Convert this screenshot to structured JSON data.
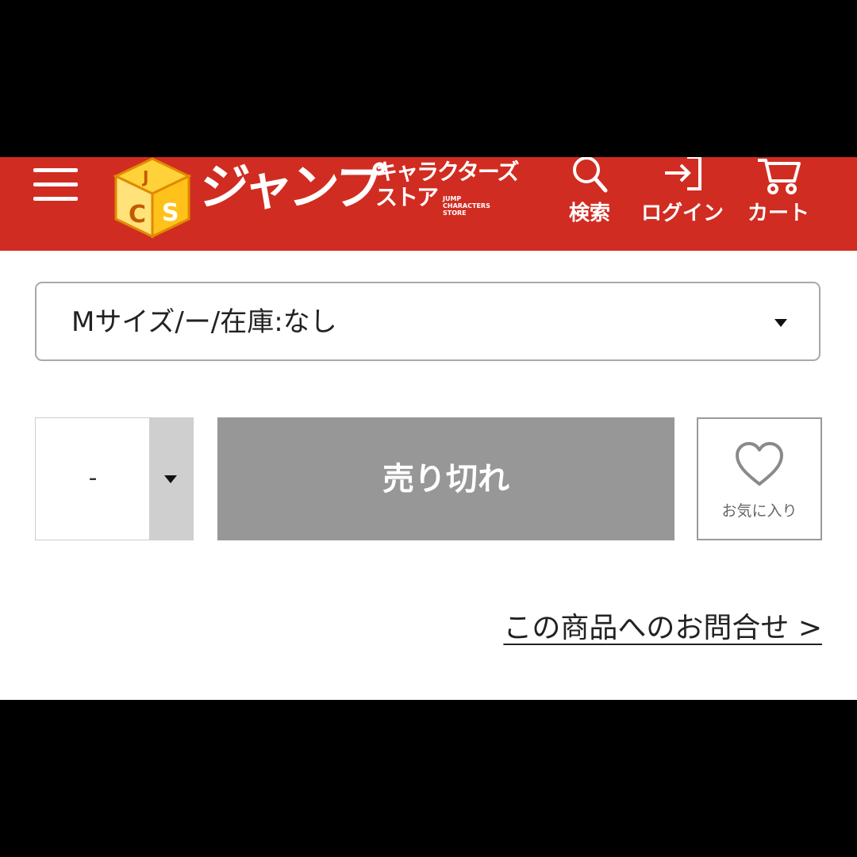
{
  "header": {
    "logo": {
      "main": "ジャンプ",
      "sub_line1": "キャラクターズ",
      "sub_line2": "ストア",
      "en_line1": "JUMP",
      "en_line2": "CHARACTERS",
      "en_line3": "STORE",
      "cube_letters": "CS"
    },
    "nav": {
      "search_label": "検索",
      "login_label": "ログイン",
      "cart_label": "カート"
    },
    "icons": {
      "menu": "hamburger-menu-icon",
      "search": "search-icon",
      "login": "login-icon",
      "cart": "cart-icon"
    },
    "background_color": "#d12c22"
  },
  "product": {
    "variant_select": {
      "selected": "Mサイズ/ー/在庫:なし"
    },
    "quantity": {
      "value": "-"
    },
    "soldout_label": "売り切れ",
    "favorite_label": "お気に入り",
    "inquiry_link": "この商品へのお問合せ >"
  },
  "colors": {
    "soldout_button": "#979797",
    "quantity_arrow_bg": "#cfcfcf"
  }
}
